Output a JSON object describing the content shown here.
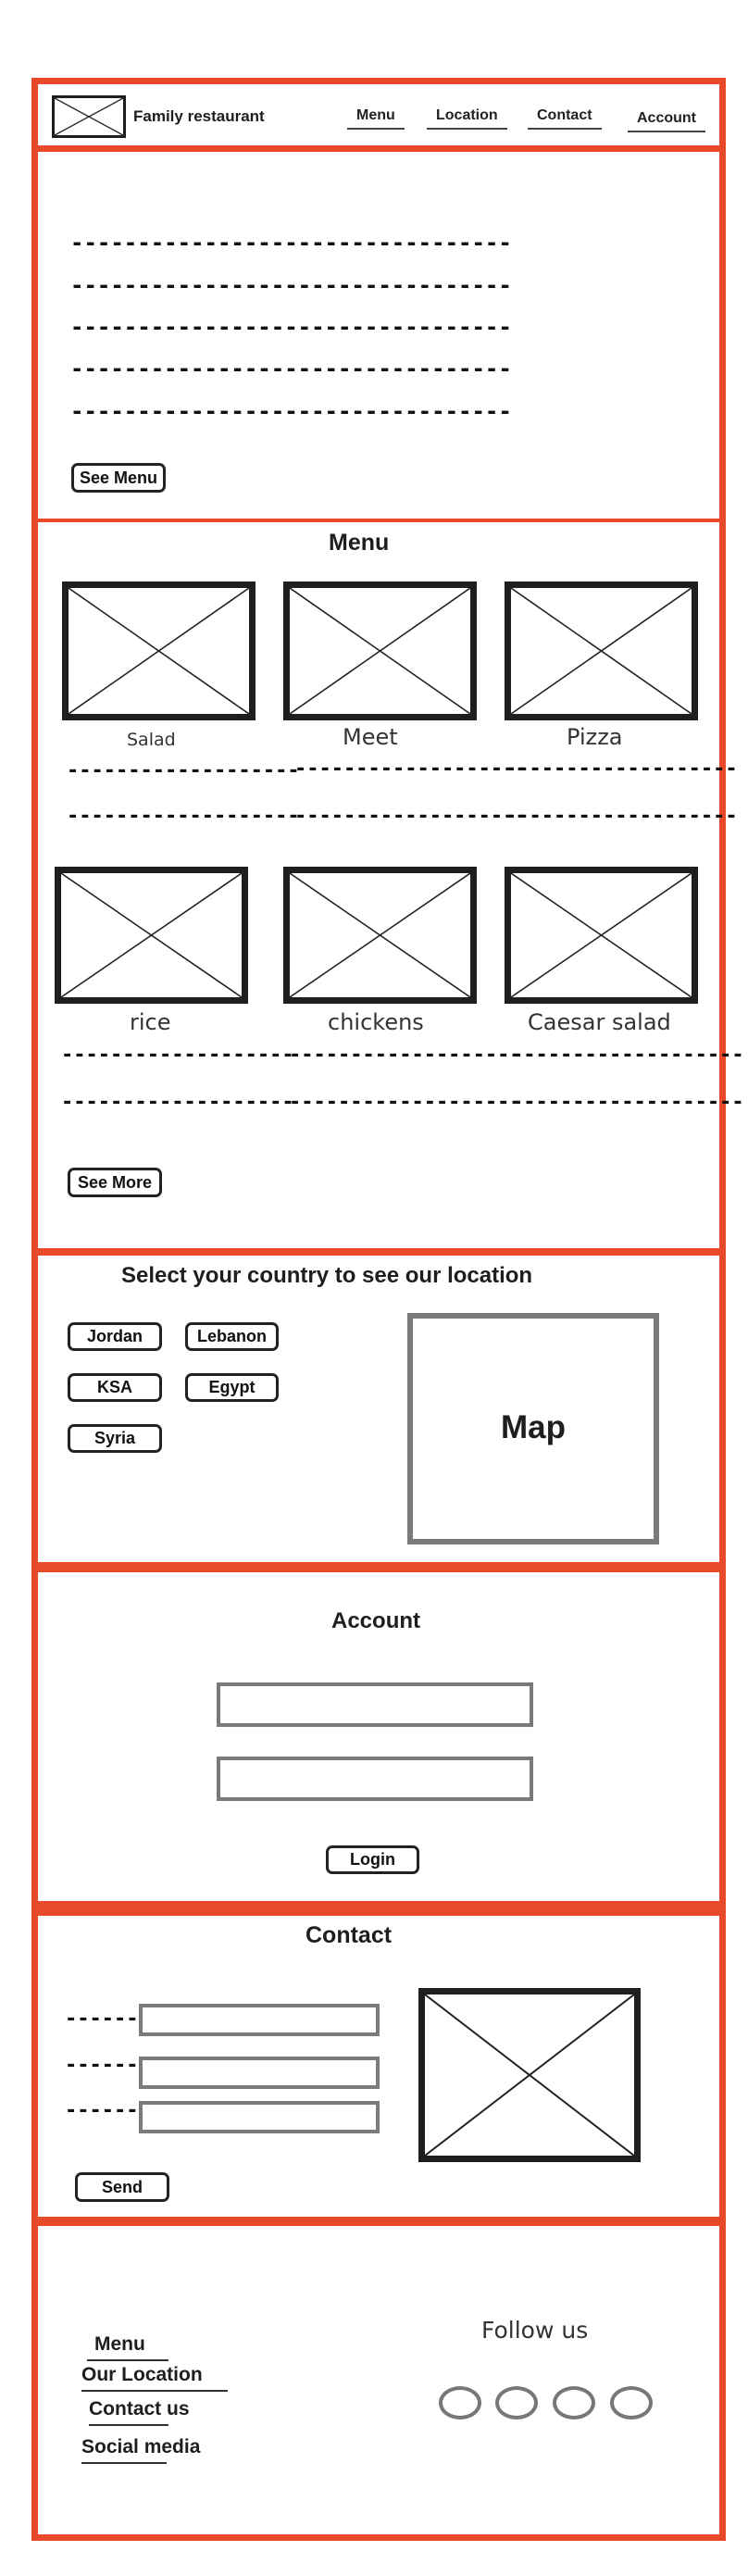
{
  "header": {
    "title": "Family restaurant",
    "nav": [
      "Menu",
      "Location",
      "Contact",
      "Account"
    ]
  },
  "hero": {
    "placeholder_line": "---------------------------------",
    "cta": "See Menu"
  },
  "menu": {
    "title": "Menu",
    "items": [
      "Salad",
      "Meet",
      "Pizza",
      "rice",
      "chickens",
      "Caesar salad"
    ],
    "desc_line": "-------------------",
    "more": "See More"
  },
  "location": {
    "title": "Select your country to see our location",
    "countries": [
      "Jordan",
      "Lebanon",
      "KSA",
      "Egypt",
      "Syria"
    ],
    "map_label": "Map"
  },
  "account": {
    "title": "Account",
    "login": "Login"
  },
  "contact": {
    "title": "Contact",
    "field_label": "------",
    "send": "Send"
  },
  "footer": {
    "links": [
      "Menu",
      "Our Location",
      "Contact us",
      "Social media"
    ],
    "follow": "Follow us"
  },
  "colors": {
    "accent": "#e8492b",
    "ink": "#1e1e1e",
    "field_border": "#7a7a7a"
  }
}
